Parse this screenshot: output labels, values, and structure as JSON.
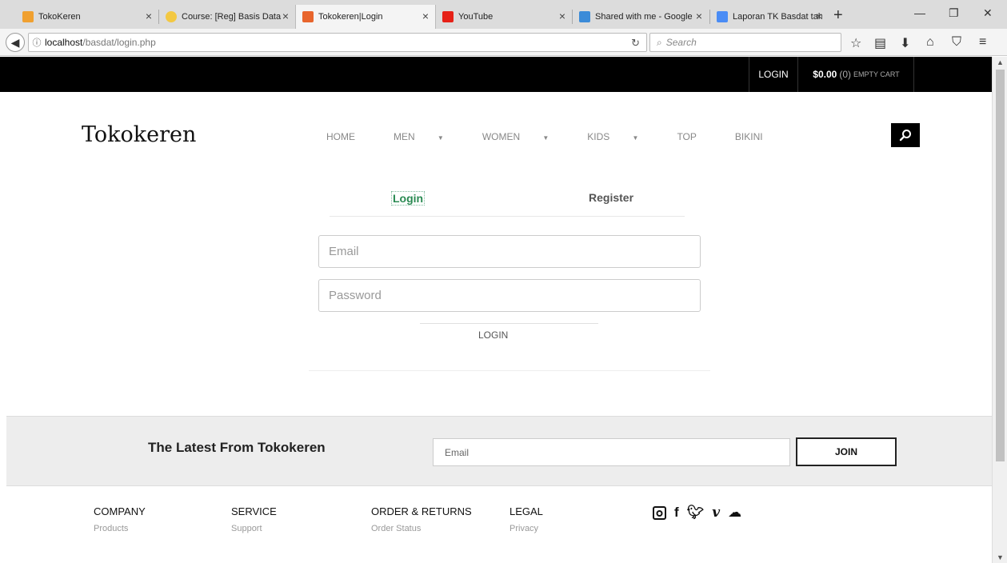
{
  "browser": {
    "tabs": [
      {
        "title": "TokoKeren",
        "color": "#f0a030"
      },
      {
        "title": "Course: [Reg] Basis Data",
        "color": "#f3c842"
      },
      {
        "title": "Tokokeren|Login",
        "color": "#e8652d"
      },
      {
        "title": "YouTube",
        "color": "#e62117"
      },
      {
        "title": "Shared with me - Google",
        "color": "#3b8bd8"
      },
      {
        "title": "Laporan TK Basdat tahap",
        "color": "#4a8cf5"
      }
    ],
    "url_host": "localhost",
    "url_path": "/basdat/login.php",
    "search_placeholder": "Search"
  },
  "topbar": {
    "login_label": "LOGIN",
    "cart_amount": "$0.00",
    "cart_count": "(0)",
    "cart_label": "EMPTY CART"
  },
  "site": {
    "logo": "Tokokeren",
    "menu": [
      {
        "label": "HOME",
        "dropdown": false
      },
      {
        "label": "MEN",
        "dropdown": true
      },
      {
        "label": "WOMEN",
        "dropdown": true
      },
      {
        "label": "KIDS",
        "dropdown": true
      },
      {
        "label": "TOP",
        "dropdown": false
      },
      {
        "label": "BIKINI",
        "dropdown": false
      }
    ]
  },
  "auth": {
    "login_tab": "Login",
    "register_tab": "Register",
    "email_placeholder": "Email",
    "password_placeholder": "Password",
    "submit_label": "LOGIN"
  },
  "newsletter": {
    "title": "The Latest From Tokokeren",
    "email_placeholder": "Email",
    "join_label": "JOIN"
  },
  "footer": {
    "columns": [
      {
        "heading": "COMPANY",
        "link": "Products"
      },
      {
        "heading": "SERVICE",
        "link": "Support"
      },
      {
        "heading": "ORDER & RETURNS",
        "link": "Order Status"
      },
      {
        "heading": "LEGAL",
        "link": "Privacy"
      }
    ]
  },
  "colors": {
    "accent_green": "#2a8a52",
    "topbar": "#000000"
  }
}
